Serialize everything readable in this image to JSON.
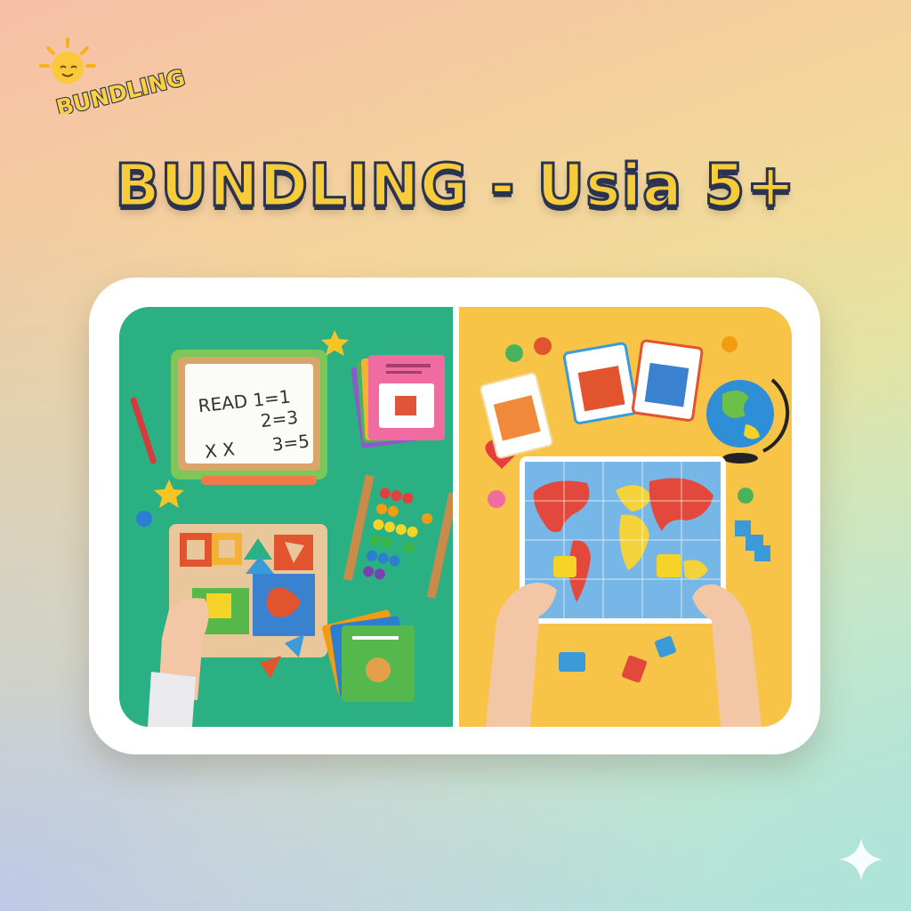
{
  "brand": {
    "logo_text": "BUNDLING"
  },
  "header": {
    "title": "BUNDLING - Usia 5+"
  },
  "left_panel": {
    "whiteboard_lines": [
      "READ 1=1",
      "2=3",
      "X X",
      "3=5"
    ],
    "icon": "learning-toys-scene"
  },
  "right_panel": {
    "icon": "world-map-puzzle-scene"
  },
  "colors": {
    "title_fill": "#f7cc3a",
    "title_outline": "#2b3350",
    "left_panel_bg": "#2bb083",
    "right_panel_bg": "#f8c447"
  },
  "decor_icon": "sparkle-icon"
}
